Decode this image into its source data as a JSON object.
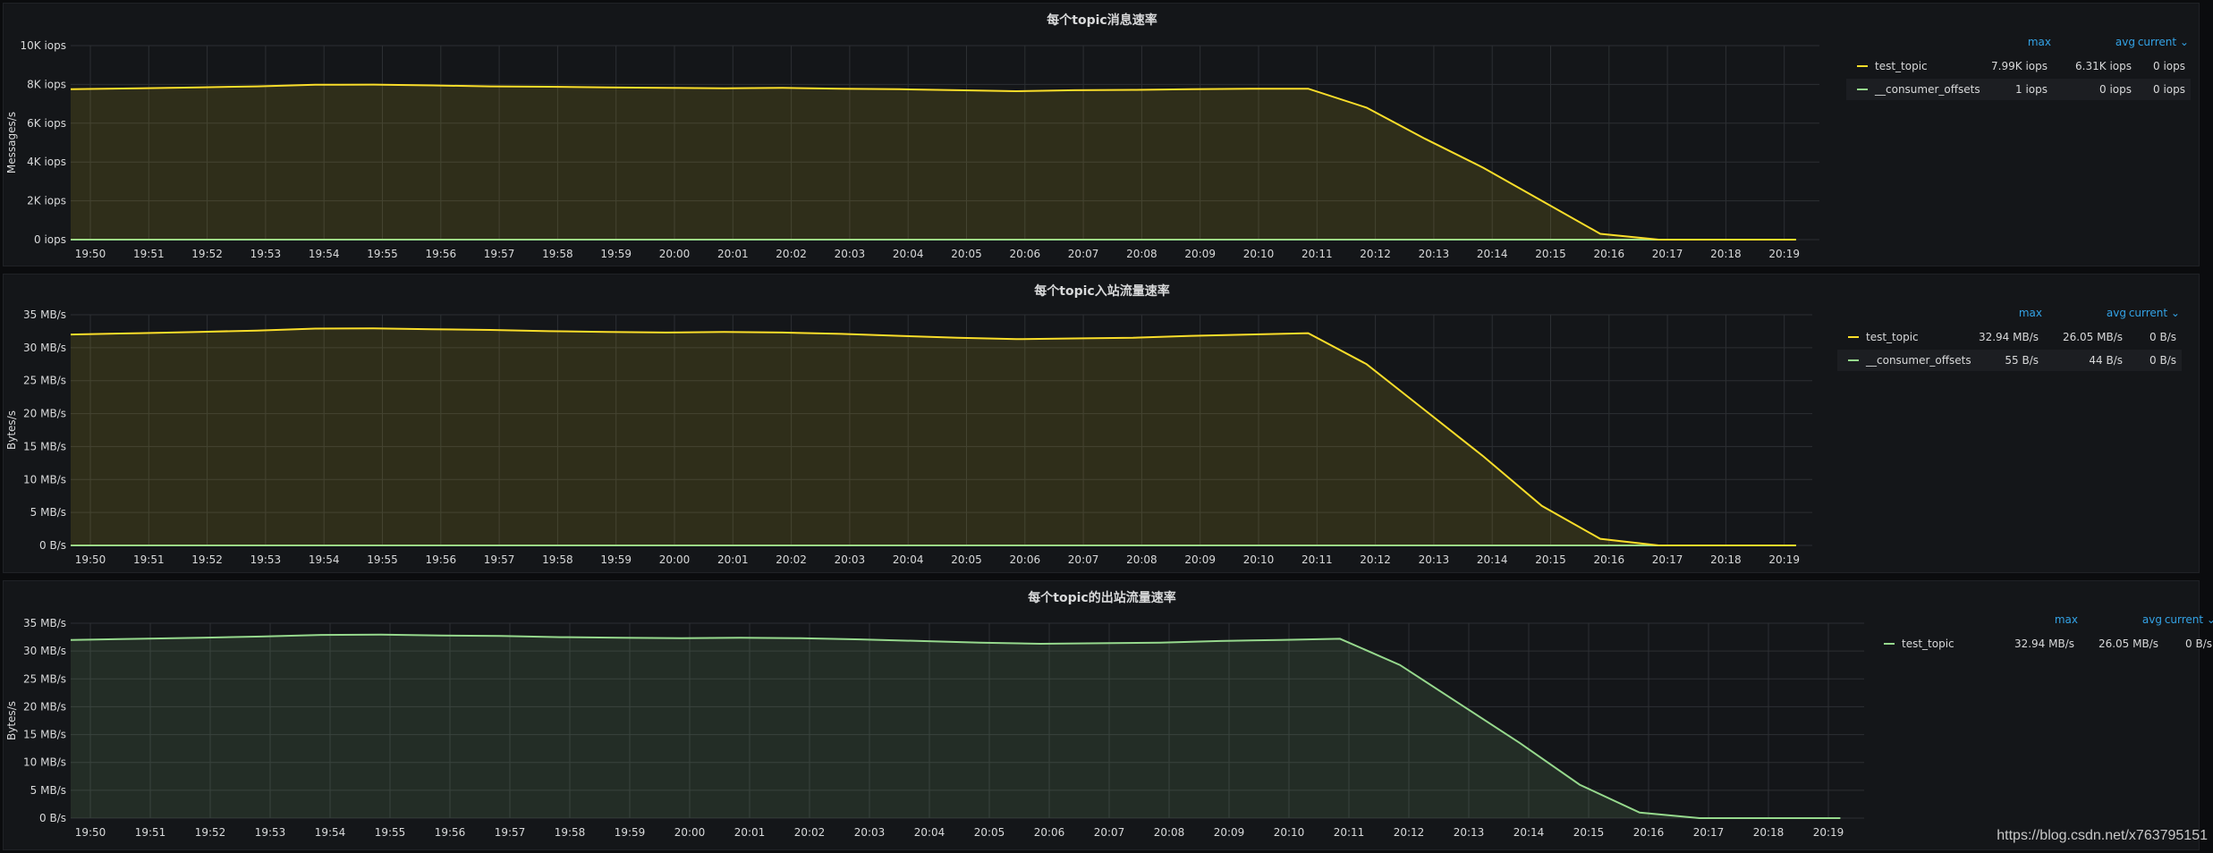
{
  "colors": {
    "yellow": "#fade2a",
    "green": "#96d98d",
    "legend_head": "#33a2e5"
  },
  "legend_headers": {
    "max": "max",
    "avg": "avg",
    "current": "current ⌄"
  },
  "watermark": "https://blog.csdn.net/x763795151",
  "chart_data": [
    {
      "type": "area",
      "title": "每个topic消息速率",
      "ylabel": "Messages/s",
      "ylim": [
        0,
        10000
      ],
      "yticks": [
        "0 iops",
        "2K iops",
        "4K iops",
        "6K iops",
        "8K iops",
        "10K iops"
      ],
      "x": [
        "19:50",
        "19:51",
        "19:52",
        "19:53",
        "19:54",
        "19:55",
        "19:56",
        "19:57",
        "19:58",
        "19:59",
        "20:00",
        "20:01",
        "20:02",
        "20:03",
        "20:04",
        "20:05",
        "20:06",
        "20:07",
        "20:08",
        "20:09",
        "20:10",
        "20:11",
        "20:12",
        "20:13",
        "20:14",
        "20:15",
        "20:16",
        "20:17",
        "20:18",
        "20:19"
      ],
      "series": [
        {
          "name": "test_topic",
          "color": "#fade2a",
          "values": [
            7750,
            7800,
            7850,
            7900,
            7980,
            7990,
            7950,
            7900,
            7880,
            7850,
            7820,
            7800,
            7820,
            7780,
            7750,
            7700,
            7650,
            7700,
            7720,
            7750,
            7780,
            7780,
            6800,
            5200,
            3700,
            2000,
            300,
            0,
            0,
            0
          ],
          "max": "7.99K iops",
          "avg": "6.31K iops",
          "current": "0 iops"
        },
        {
          "name": "__consumer_offsets",
          "color": "#96d98d",
          "values": [
            1,
            1,
            1,
            1,
            1,
            1,
            1,
            1,
            1,
            1,
            1,
            1,
            1,
            1,
            1,
            1,
            1,
            1,
            1,
            1,
            1,
            1,
            1,
            1,
            1,
            1,
            0,
            0,
            0,
            0
          ],
          "max": "1 iops",
          "avg": "0 iops",
          "current": "0 iops"
        }
      ]
    },
    {
      "type": "area",
      "title": "每个topic入站流量速率",
      "ylabel": "Bytes/s",
      "ylim": [
        0,
        35
      ],
      "yticks": [
        "0 B/s",
        "5 MB/s",
        "10 MB/s",
        "15 MB/s",
        "20 MB/s",
        "25 MB/s",
        "30 MB/s",
        "35 MB/s"
      ],
      "x": [
        "19:50",
        "19:51",
        "19:52",
        "19:53",
        "19:54",
        "19:55",
        "19:56",
        "19:57",
        "19:58",
        "19:59",
        "20:00",
        "20:01",
        "20:02",
        "20:03",
        "20:04",
        "20:05",
        "20:06",
        "20:07",
        "20:08",
        "20:09",
        "20:10",
        "20:11",
        "20:12",
        "20:13",
        "20:14",
        "20:15",
        "20:16",
        "20:17",
        "20:18",
        "20:19"
      ],
      "series": [
        {
          "name": "test_topic",
          "color": "#fade2a",
          "values": [
            32.0,
            32.2,
            32.4,
            32.6,
            32.9,
            32.94,
            32.8,
            32.7,
            32.5,
            32.4,
            32.3,
            32.4,
            32.3,
            32.1,
            31.8,
            31.5,
            31.3,
            31.4,
            31.5,
            31.8,
            32.0,
            32.2,
            27.5,
            20.5,
            13.5,
            6.0,
            1.0,
            0,
            0,
            0
          ],
          "max": "32.94 MB/s",
          "avg": "26.05 MB/s",
          "current": "0 B/s"
        },
        {
          "name": "__consumer_offsets",
          "color": "#96d98d",
          "values": [
            0.0001,
            0.0001,
            0.0001,
            0.0001,
            0.0001,
            0.0001,
            0.0001,
            0.0001,
            0.0001,
            0.0001,
            0.0001,
            0.0001,
            0.0001,
            0.0001,
            0.0001,
            0.0001,
            0.0001,
            0.0001,
            0.0001,
            0.0001,
            0.0001,
            0.0001,
            0.0001,
            0.0001,
            0.0001,
            0.0001,
            0,
            0,
            0,
            0
          ],
          "max": "55 B/s",
          "avg": "44 B/s",
          "current": "0 B/s"
        }
      ]
    },
    {
      "type": "area",
      "title": "每个topic的出站流量速率",
      "ylabel": "Bytes/s",
      "ylim": [
        0,
        35
      ],
      "yticks": [
        "0 B/s",
        "5 MB/s",
        "10 MB/s",
        "15 MB/s",
        "20 MB/s",
        "25 MB/s",
        "30 MB/s",
        "35 MB/s"
      ],
      "x": [
        "19:50",
        "19:51",
        "19:52",
        "19:53",
        "19:54",
        "19:55",
        "19:56",
        "19:57",
        "19:58",
        "19:59",
        "20:00",
        "20:01",
        "20:02",
        "20:03",
        "20:04",
        "20:05",
        "20:06",
        "20:07",
        "20:08",
        "20:09",
        "20:10",
        "20:11",
        "20:12",
        "20:13",
        "20:14",
        "20:15",
        "20:16",
        "20:17",
        "20:18",
        "20:19"
      ],
      "series": [
        {
          "name": "test_topic",
          "color": "#96d98d",
          "values": [
            32.0,
            32.2,
            32.4,
            32.6,
            32.9,
            32.94,
            32.8,
            32.7,
            32.5,
            32.4,
            32.3,
            32.4,
            32.3,
            32.1,
            31.8,
            31.5,
            31.3,
            31.4,
            31.5,
            31.8,
            32.0,
            32.2,
            27.5,
            20.5,
            13.5,
            6.0,
            1.0,
            0,
            0,
            0
          ],
          "max": "32.94 MB/s",
          "avg": "26.05 MB/s",
          "current": "0 B/s"
        }
      ]
    }
  ]
}
